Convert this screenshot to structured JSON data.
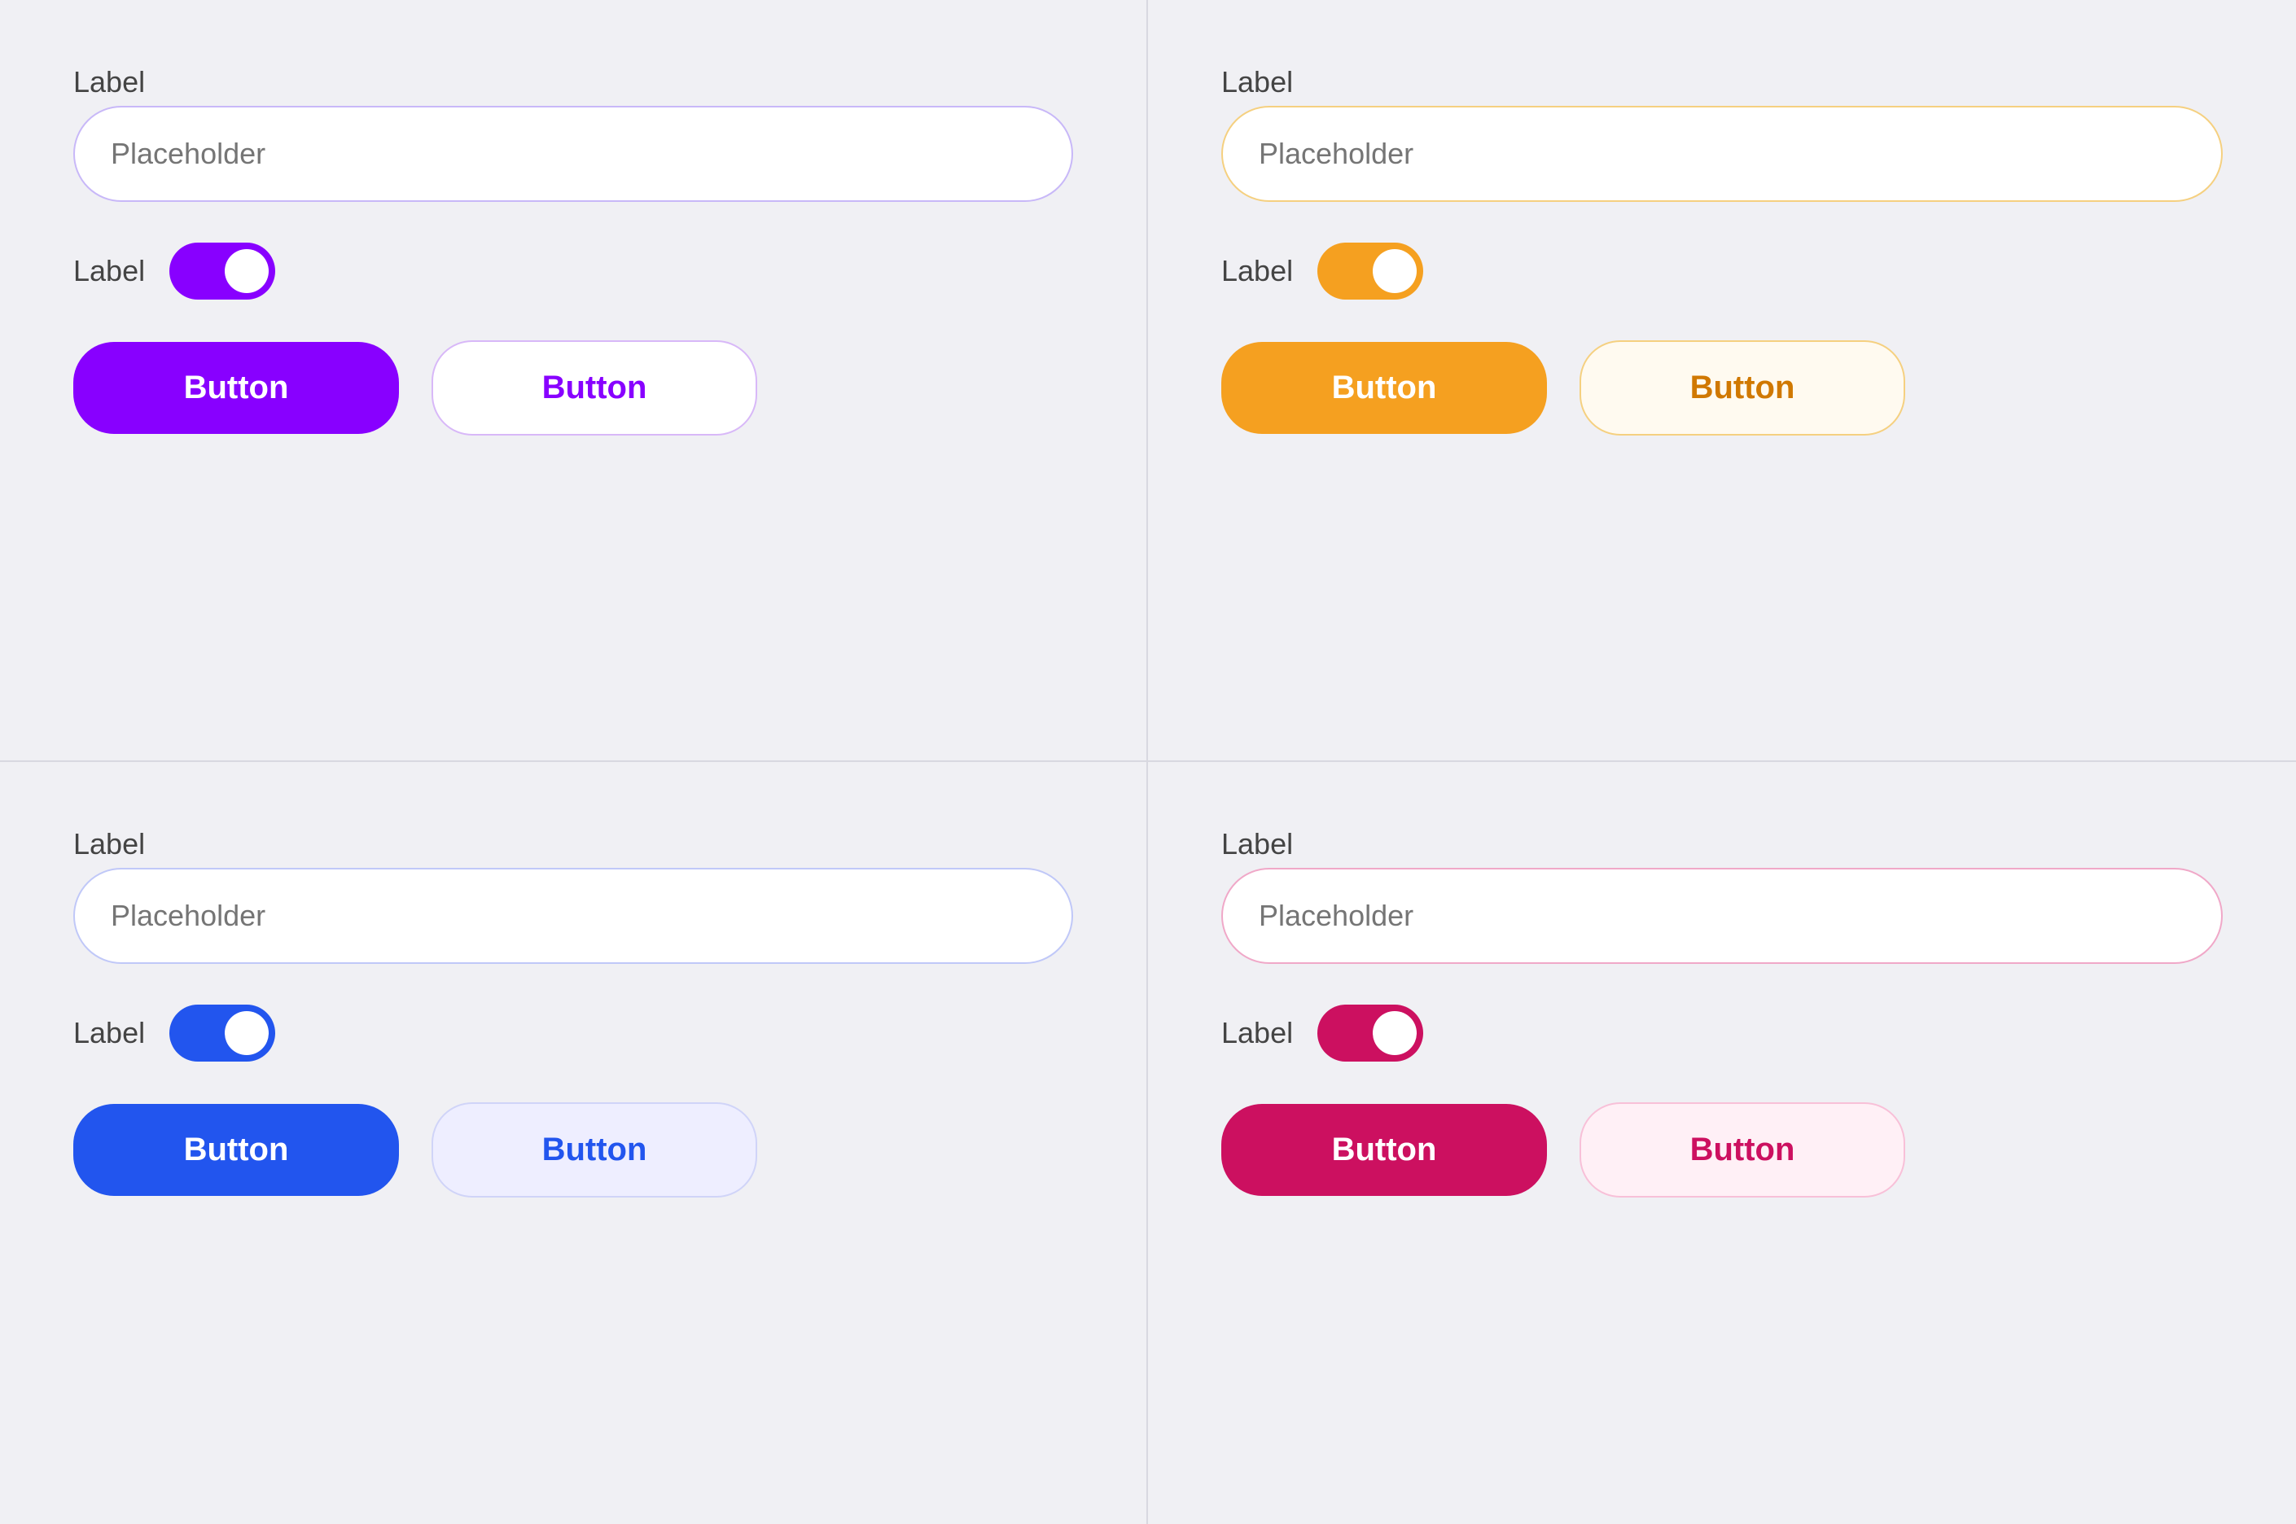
{
  "quadrants": [
    {
      "id": "purple",
      "theme": "purple",
      "field": {
        "label": "Label",
        "placeholder": "Placeholder",
        "input_class": "input-purple"
      },
      "toggle": {
        "label": "Label",
        "toggle_class": "toggle-purple"
      },
      "buttons": {
        "solid_label": "Button",
        "outline_label": "Button",
        "solid_class": "btn-solid-purple",
        "outline_class": "btn-outline-purple"
      }
    },
    {
      "id": "orange",
      "theme": "orange",
      "field": {
        "label": "Label",
        "placeholder": "Placeholder",
        "input_class": "input-orange"
      },
      "toggle": {
        "label": "Label",
        "toggle_class": "toggle-orange"
      },
      "buttons": {
        "solid_label": "Button",
        "outline_label": "Button",
        "solid_class": "btn-solid-orange",
        "outline_class": "btn-outline-orange"
      }
    },
    {
      "id": "blue",
      "theme": "blue",
      "field": {
        "label": "Label",
        "placeholder": "Placeholder",
        "input_class": "input-blue"
      },
      "toggle": {
        "label": "Label",
        "toggle_class": "toggle-blue"
      },
      "buttons": {
        "solid_label": "Button",
        "outline_label": "Button",
        "solid_class": "btn-solid-blue",
        "outline_class": "btn-outline-blue"
      }
    },
    {
      "id": "pink",
      "theme": "pink",
      "field": {
        "label": "Label",
        "placeholder": "Placeholder",
        "input_class": "input-pink"
      },
      "toggle": {
        "label": "Label",
        "toggle_class": "toggle-pink"
      },
      "buttons": {
        "solid_label": "Button",
        "outline_label": "Button",
        "solid_class": "btn-solid-pink",
        "outline_class": "btn-outline-pink"
      }
    }
  ]
}
